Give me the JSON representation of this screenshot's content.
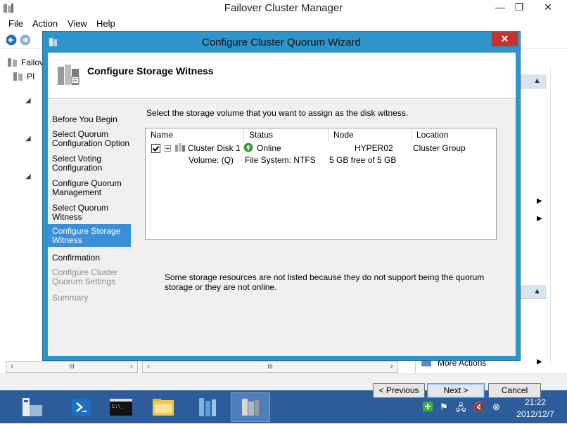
{
  "main_window": {
    "title": "Failover Cluster Manager",
    "menu": [
      "File",
      "Action",
      "View",
      "Help"
    ],
    "tree_root_label": "Failov",
    "tree_child_label": "PI",
    "actions_more": "More Actions",
    "controls": {
      "minimize": "—",
      "restore": "❐",
      "close": "✕"
    }
  },
  "wizard": {
    "title": "Configure Cluster Quorum Wizard",
    "close_glyph": "✕",
    "page_title": "Configure Storage Witness",
    "steps": [
      {
        "label": "Before You Begin",
        "state": "normal"
      },
      {
        "label": "Select Quorum Configuration Option",
        "state": "normal"
      },
      {
        "label": "Select Voting Configuration",
        "state": "normal"
      },
      {
        "label": "Configure Quorum Management",
        "state": "normal"
      },
      {
        "label": "Select Quorum Witness",
        "state": "normal"
      },
      {
        "label": "Configure Storage Witness",
        "state": "current"
      },
      {
        "label": "Confirmation",
        "state": "normal"
      },
      {
        "label": "Configure Cluster Quorum Settings",
        "state": "disabled"
      },
      {
        "label": "Summary",
        "state": "disabled"
      }
    ],
    "instruction": "Select the storage volume that you want to assign as the disk witness.",
    "grid": {
      "columns": [
        "Name",
        "Status",
        "Node",
        "Location"
      ],
      "row": {
        "checked": true,
        "name": "Cluster Disk 1",
        "status": "Online",
        "node": "HYPER02",
        "location": "Cluster Group"
      },
      "detail": {
        "volume": "Volume: (Q)",
        "filesystem": "File System: NTFS",
        "free": "5 GB free of 5 GB"
      }
    },
    "note": "Some storage resources are not listed because they do not support being the quorum storage or they are not online.",
    "buttons": {
      "previous": "< Previous",
      "next": "Next >",
      "cancel": "Cancel"
    }
  },
  "taskbar": {
    "time": "21:22",
    "date": "2012/12/7"
  },
  "colors": {
    "wizard_frame": "#2e94c9",
    "current_step": "#3b8fd6",
    "taskbar": "#2c5d9a",
    "close_button": "#c7302b"
  }
}
